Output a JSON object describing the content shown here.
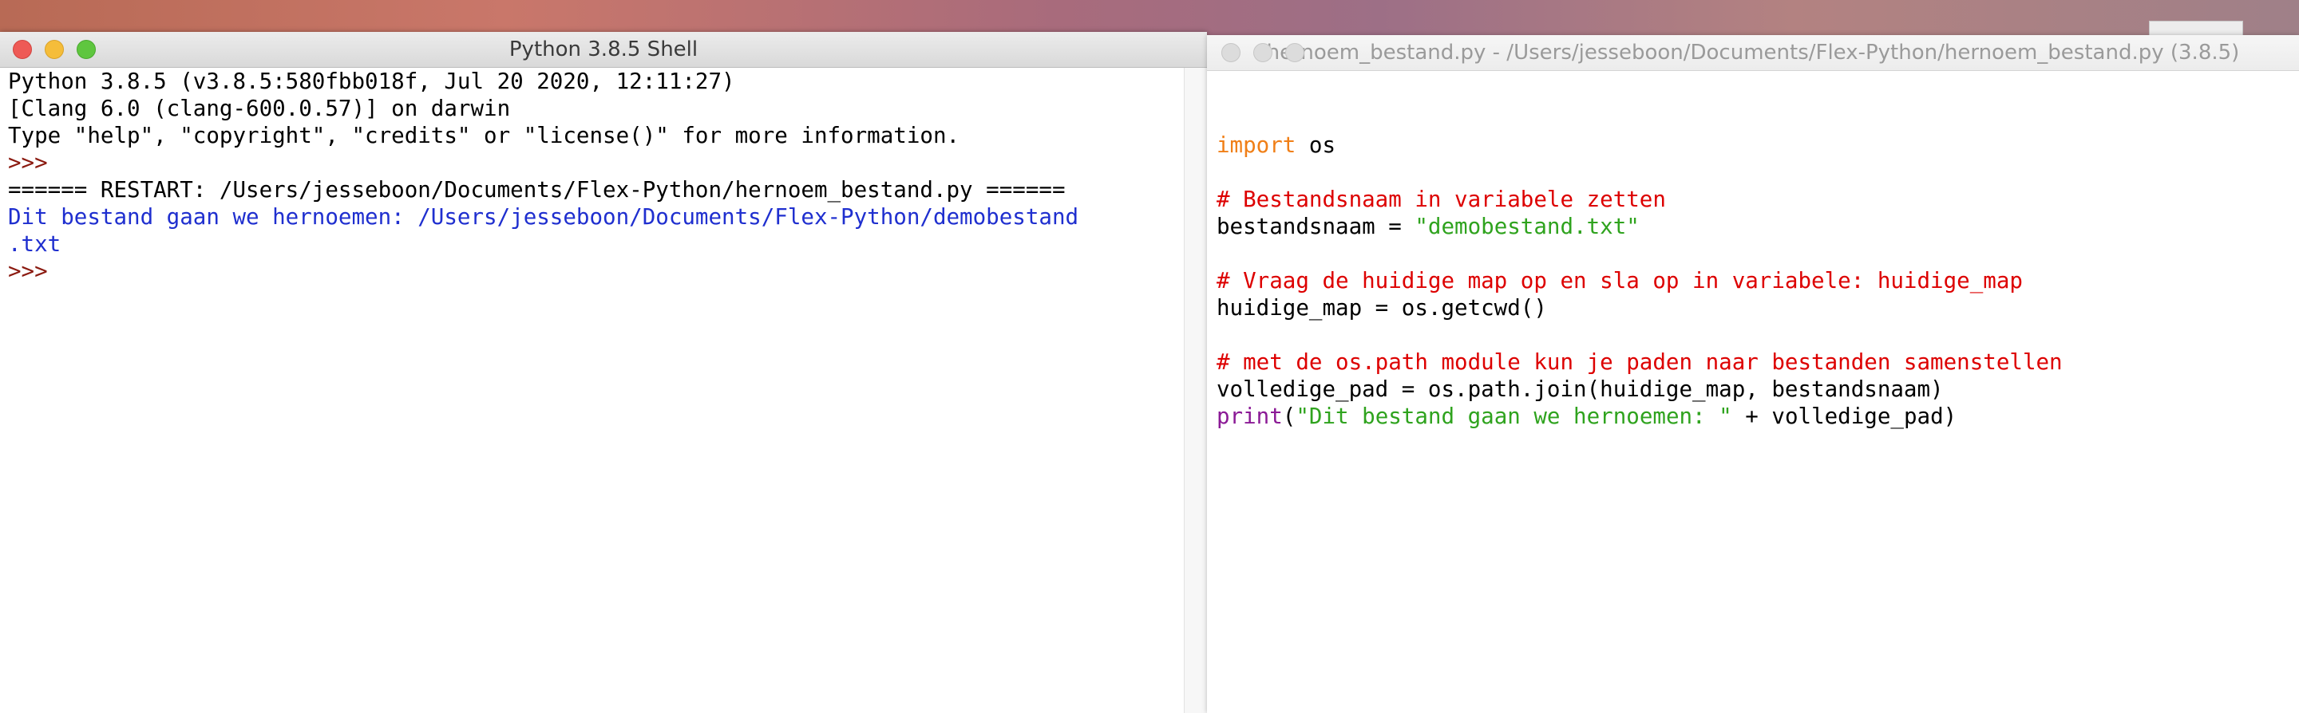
{
  "shell_window": {
    "title": "Python 3.8.5 Shell",
    "lines": [
      {
        "text": "Python 3.8.5 (v3.8.5:580fbb018f, Jul 20 2020, 12:11:27)",
        "type": "plain"
      },
      {
        "text": "[Clang 6.0 (clang-600.0.57)] on darwin",
        "type": "plain"
      },
      {
        "text": "Type \"help\", \"copyright\", \"credits\" or \"license()\" for more information.",
        "type": "plain"
      },
      {
        "text": ">>>",
        "type": "prompt"
      },
      {
        "text": "====== RESTART: /Users/jesseboon/Documents/Flex-Python/hernoem_bestand.py ======",
        "type": "plain"
      },
      {
        "text": "Dit bestand gaan we hernoemen: /Users/jesseboon/Documents/Flex-Python/demobestand",
        "type": "stdout"
      },
      {
        "text": ".txt",
        "type": "stdout"
      },
      {
        "text": ">>>",
        "type": "prompt"
      }
    ]
  },
  "editor_window": {
    "title": "hernoem_bestand.py - /Users/jesseboon/Documents/Flex-Python/hernoem_bestand.py (3.8.5)",
    "code": {
      "l1_kw": "import",
      "l1_rest": " os",
      "l3_comment": "# Bestandsnaam in variabele zetten",
      "l4_lhs": "bestandsnaam = ",
      "l4_str": "\"demobestand.txt\"",
      "l6_comment": "# Vraag de huidige map op en sla op in variabele: huidige_map",
      "l7_code": "huidige_map = os.getcwd()",
      "l9_comment": "# met de os.path module kun je paden naar bestanden samenstellen",
      "l10_code": "volledige_pad = os.path.join(huidige_map, bestandsnaam)",
      "l11_builtin": "print",
      "l11_open": "(",
      "l11_str": "\"Dit bestand gaan we hernoemen: \"",
      "l11_rest": " + volledige_pad)"
    }
  },
  "colors": {
    "keyword": "#f07f17",
    "comment": "#dd0000",
    "string": "#2fa31e",
    "builtin": "#8b1a96",
    "stdout": "#1f2fcf",
    "prompt": "#8b1a10"
  }
}
